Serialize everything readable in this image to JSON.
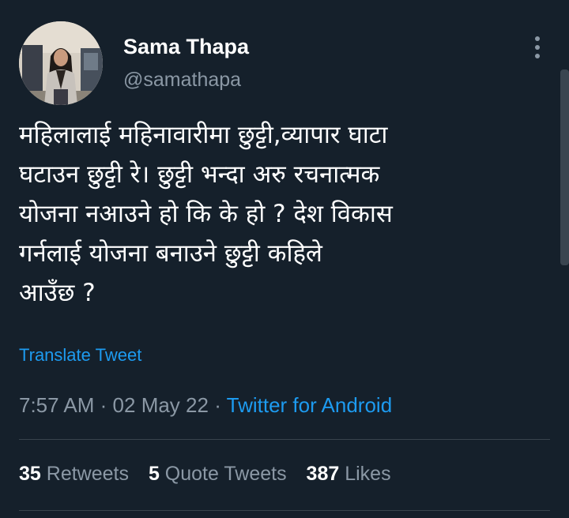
{
  "author": {
    "display_name": "Sama Thapa",
    "handle": "@samathapa"
  },
  "tweet": {
    "lines": [
      "महिलालाई महिनावारीमा छुट्टी,व्यापार घाटा",
      "घटाउन छुट्टी रे। छुट्टी भन्दा अरु रचनात्मक",
      "योजना नआउने हो कि के हो ? देश विकास",
      "गर्नलाई योजना बनाउने छुट्टी कहिले",
      "आउँछ ?"
    ],
    "translate_label": "Translate Tweet",
    "time": "7:57 AM",
    "date": "02 May 22",
    "separator": "·",
    "source": "Twitter for Android"
  },
  "stats": {
    "retweets": {
      "count": "35",
      "label": "Retweets"
    },
    "quote_tweets": {
      "count": "5",
      "label": "Quote Tweets"
    },
    "likes": {
      "count": "387",
      "label": "Likes"
    }
  },
  "icons": {
    "more": "more-vertical-icon"
  },
  "colors": {
    "background": "#15202b",
    "text_primary": "#ffffff",
    "text_secondary": "#8b98a5",
    "link": "#1d9bf0",
    "divider": "#38444d"
  }
}
